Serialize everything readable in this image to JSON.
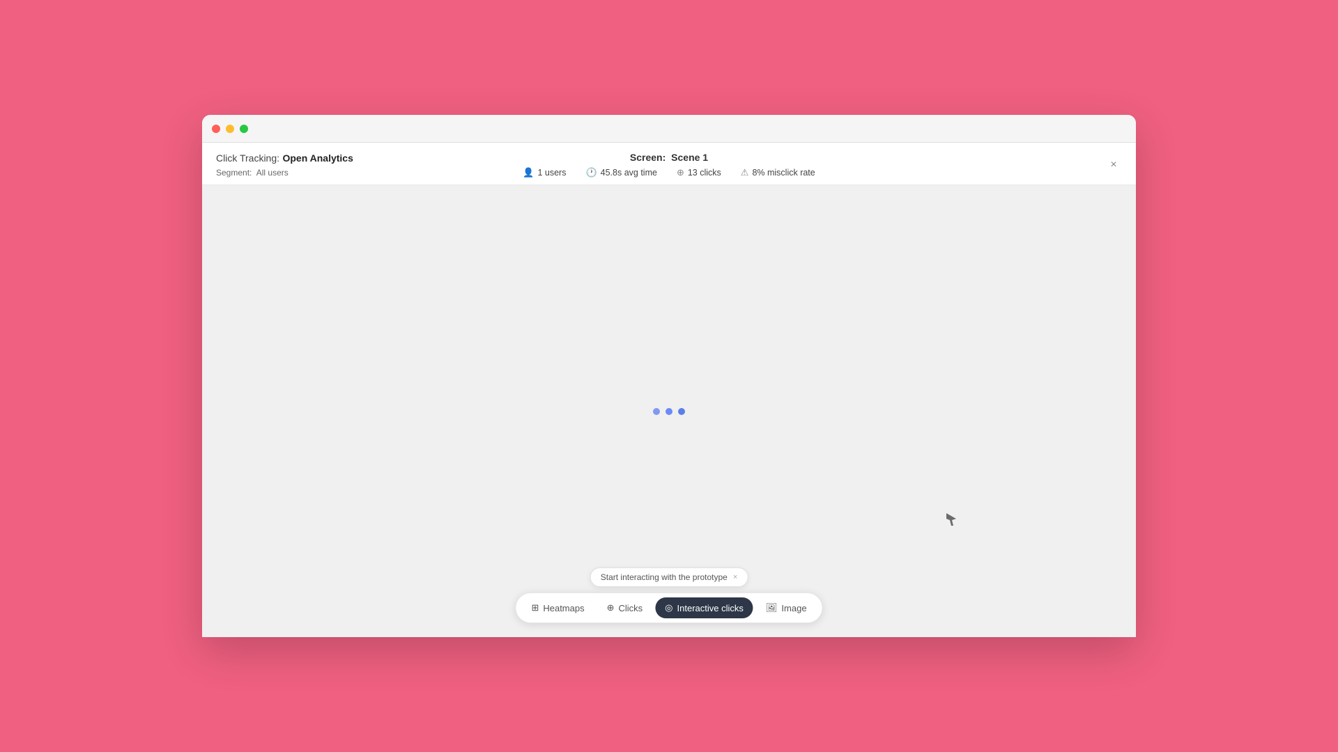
{
  "window": {
    "title_prefix": "Click Tracking:",
    "title_app": "Open Analytics",
    "segment_label": "Segment:",
    "segment_value": "All users",
    "close_label": "×"
  },
  "header": {
    "screen_label": "Screen:",
    "screen_name": "Scene 1"
  },
  "stats": {
    "users_count": "1 users",
    "avg_time": "45.8s avg time",
    "clicks": "13 clicks",
    "misclick_rate": "8% misclick rate"
  },
  "loading": {
    "dots_count": 3
  },
  "tooltip": {
    "text": "Start interacting with the prototype",
    "close": "×"
  },
  "tabs": [
    {
      "id": "heatmaps",
      "label": "Heatmaps",
      "icon": "⊞",
      "active": false
    },
    {
      "id": "clicks",
      "label": "Clicks",
      "icon": "⊕",
      "active": false
    },
    {
      "id": "interactive-clicks",
      "label": "Interactive clicks",
      "icon": "◎",
      "active": true
    },
    {
      "id": "image",
      "label": "Image",
      "icon": "⊞",
      "active": false
    }
  ],
  "colors": {
    "background": "#f06080",
    "window_bg": "#ffffff",
    "content_bg": "#f0f0f0",
    "active_tab": "#2d3748",
    "loading_dot": "#6b8af5"
  }
}
